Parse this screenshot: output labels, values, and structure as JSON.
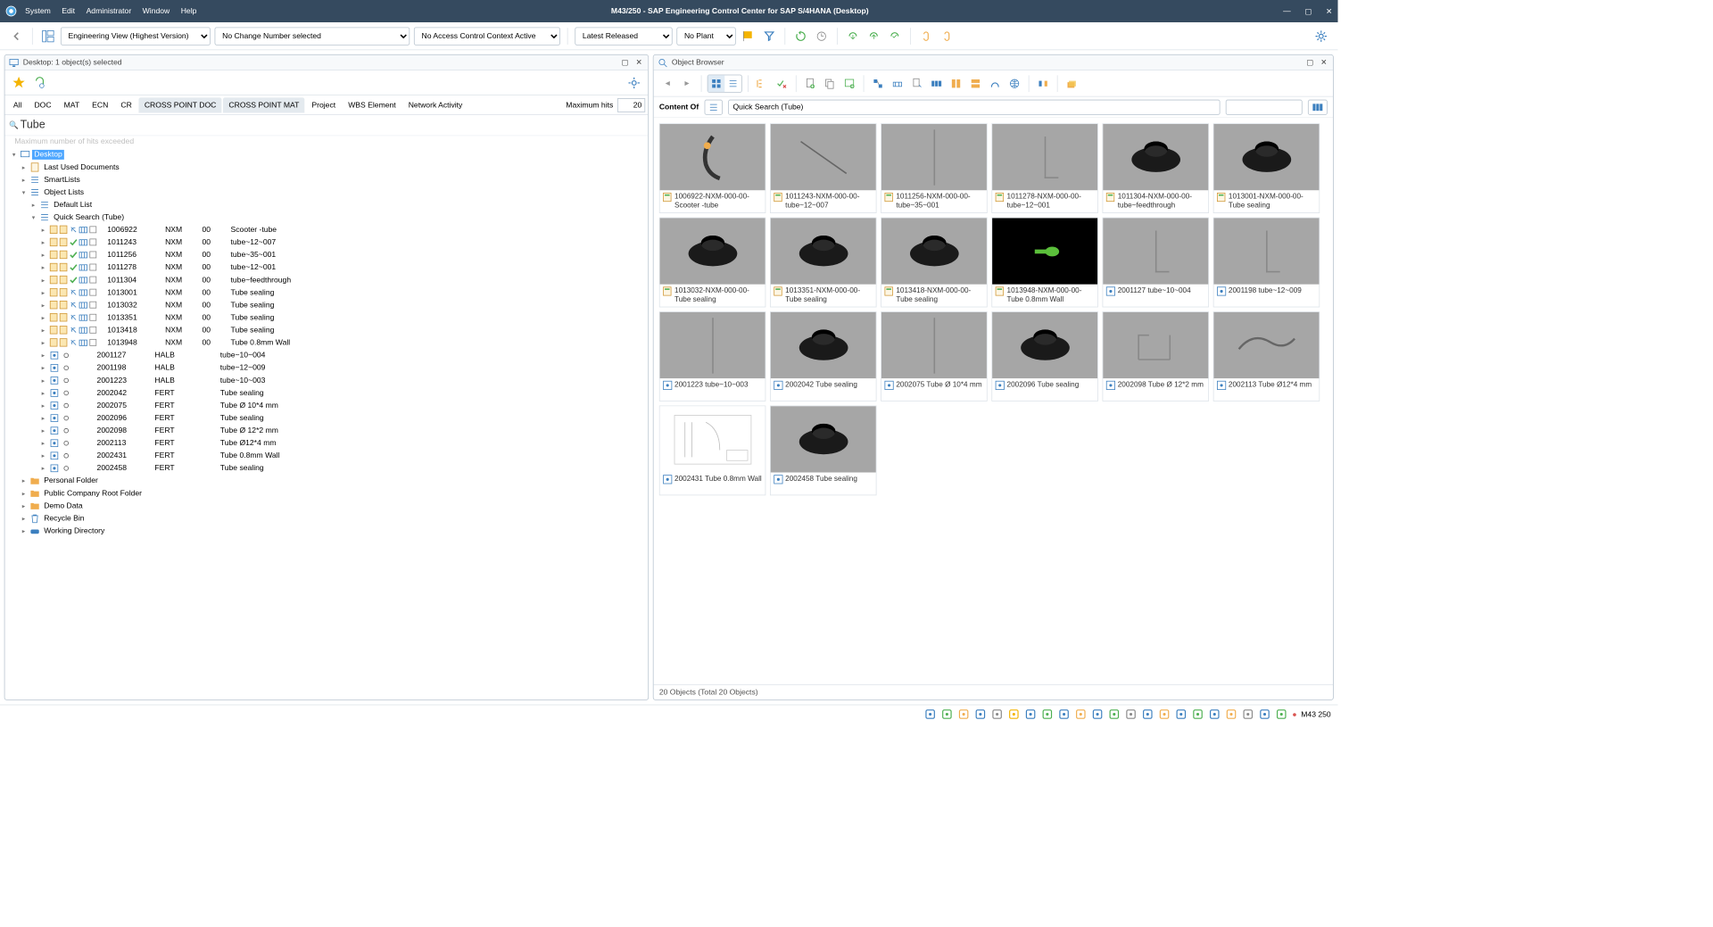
{
  "titlebar": {
    "menus": [
      "System",
      "Edit",
      "Administrator",
      "Window",
      "Help"
    ],
    "title": "M43/250 - SAP Engineering Control Center for SAP S/4HANA (Desktop)"
  },
  "toolbar": {
    "view": "Engineering View (Highest Version)",
    "change_number": "No Change Number selected",
    "access_context": "No Access Control Context Active",
    "release": "Latest Released",
    "plant": "No Plant"
  },
  "desktop": {
    "header": "Desktop: 1 object(s) selected",
    "tabs": [
      "All",
      "DOC",
      "MAT",
      "ECN",
      "CR",
      "CROSS POINT DOC",
      "CROSS POINT MAT",
      "Project",
      "WBS Element",
      "Network Activity"
    ],
    "active_tabs": [
      "CROSS POINT DOC",
      "CROSS POINT MAT"
    ],
    "max_hits_label": "Maximum hits",
    "max_hits_value": "20",
    "search_value": "Tube",
    "warn": "Maximum number of hits exceeded",
    "tree_top": {
      "desktop": "Desktop",
      "last_used": "Last Used Documents",
      "smartlists": "SmartLists",
      "object_lists": "Object Lists",
      "default_list": "Default List",
      "quick_search": "Quick Search (Tube)"
    },
    "doc_rows": [
      {
        "id": "1006922",
        "type": "NXM",
        "ver": "00",
        "desc": "Scooter -tube"
      },
      {
        "id": "1011243",
        "type": "NXM",
        "ver": "00",
        "desc": "tube~12~007"
      },
      {
        "id": "1011256",
        "type": "NXM",
        "ver": "00",
        "desc": "tube~35~001"
      },
      {
        "id": "1011278",
        "type": "NXM",
        "ver": "00",
        "desc": "tube~12~001"
      },
      {
        "id": "1011304",
        "type": "NXM",
        "ver": "00",
        "desc": "tube~feedthrough"
      },
      {
        "id": "1013001",
        "type": "NXM",
        "ver": "00",
        "desc": "Tube sealing"
      },
      {
        "id": "1013032",
        "type": "NXM",
        "ver": "00",
        "desc": "Tube sealing"
      },
      {
        "id": "1013351",
        "type": "NXM",
        "ver": "00",
        "desc": "Tube sealing"
      },
      {
        "id": "1013418",
        "type": "NXM",
        "ver": "00",
        "desc": "Tube sealing"
      },
      {
        "id": "1013948",
        "type": "NXM",
        "ver": "00",
        "desc": "Tube 0.8mm Wall"
      }
    ],
    "mat_rows": [
      {
        "id": "2001127",
        "type": "HALB",
        "desc": "tube~10~004"
      },
      {
        "id": "2001198",
        "type": "HALB",
        "desc": "tube~12~009"
      },
      {
        "id": "2001223",
        "type": "HALB",
        "desc": "tube~10~003"
      },
      {
        "id": "2002042",
        "type": "FERT",
        "desc": "Tube sealing"
      },
      {
        "id": "2002075",
        "type": "FERT",
        "desc": "Tube Ø 10*4 mm"
      },
      {
        "id": "2002096",
        "type": "FERT",
        "desc": "Tube sealing"
      },
      {
        "id": "2002098",
        "type": "FERT",
        "desc": "Tube Ø 12*2 mm"
      },
      {
        "id": "2002113",
        "type": "FERT",
        "desc": "Tube Ø12*4 mm"
      },
      {
        "id": "2002431",
        "type": "FERT",
        "desc": "Tube 0.8mm Wall"
      },
      {
        "id": "2002458",
        "type": "FERT",
        "desc": "Tube sealing"
      }
    ],
    "folders": [
      {
        "label": "Personal Folder",
        "icon": "folder"
      },
      {
        "label": "Public Company Root Folder",
        "icon": "folder"
      },
      {
        "label": "Demo Data",
        "icon": "folder"
      },
      {
        "label": "Recycle Bin",
        "icon": "trash"
      },
      {
        "label": "Working Directory",
        "icon": "drive"
      }
    ]
  },
  "browser": {
    "header": "Object Browser",
    "content_of_label": "Content Of",
    "search_placeholder": "Quick Search (Tube)",
    "status": "20 Objects (Total 20 Objects)",
    "thumbs": [
      {
        "label": "1006922-NXM-000-00-Scooter -tube",
        "icon": "doc",
        "shape": "scooter"
      },
      {
        "label": "1011243-NXM-000-00-tube~12~007",
        "icon": "doc",
        "shape": "diag"
      },
      {
        "label": "1011256-NXM-000-00-tube~35~001",
        "icon": "doc",
        "shape": "vert"
      },
      {
        "label": "1011278-NXM-000-00-tube~12~001",
        "icon": "doc",
        "shape": "bend"
      },
      {
        "label": "1011304-NXM-000-00-tube~feedthrough",
        "icon": "doc",
        "shape": "ring"
      },
      {
        "label": "1013001-NXM-000-00-Tube sealing",
        "icon": "doc",
        "shape": "ring"
      },
      {
        "label": "1013032-NXM-000-00-Tube sealing",
        "icon": "doc",
        "shape": "ring"
      },
      {
        "label": "1013351-NXM-000-00-Tube sealing",
        "icon": "doc",
        "shape": "ring"
      },
      {
        "label": "1013418-NXM-000-00-Tube sealing",
        "icon": "doc",
        "shape": "ring"
      },
      {
        "label": "1013948-NXM-000-00-Tube 0.8mm Wall",
        "icon": "doc",
        "shape": "green",
        "bg": "#000"
      },
      {
        "label": "2001127 tube~10~004",
        "icon": "mat",
        "shape": "bend"
      },
      {
        "label": "2001198 tube~12~009",
        "icon": "mat",
        "shape": "bend"
      },
      {
        "label": "2001223 tube~10~003",
        "icon": "mat",
        "shape": "vert"
      },
      {
        "label": "2002042 Tube sealing",
        "icon": "mat",
        "shape": "ring"
      },
      {
        "label": "2002075 Tube Ø 10*4 mm",
        "icon": "mat",
        "shape": "vert"
      },
      {
        "label": "2002096 Tube sealing",
        "icon": "mat",
        "shape": "ring"
      },
      {
        "label": "2002098 Tube Ø 12*2 mm",
        "icon": "mat",
        "shape": "frame"
      },
      {
        "label": "2002113 Tube Ø12*4 mm",
        "icon": "mat",
        "shape": "curve"
      },
      {
        "label": "2002431 Tube 0.8mm Wall",
        "icon": "mat",
        "shape": "drawing",
        "bg": "#fff"
      },
      {
        "label": "2002458 Tube sealing",
        "icon": "mat",
        "shape": "ring"
      }
    ]
  },
  "statusbar": {
    "system": "M43 250"
  }
}
